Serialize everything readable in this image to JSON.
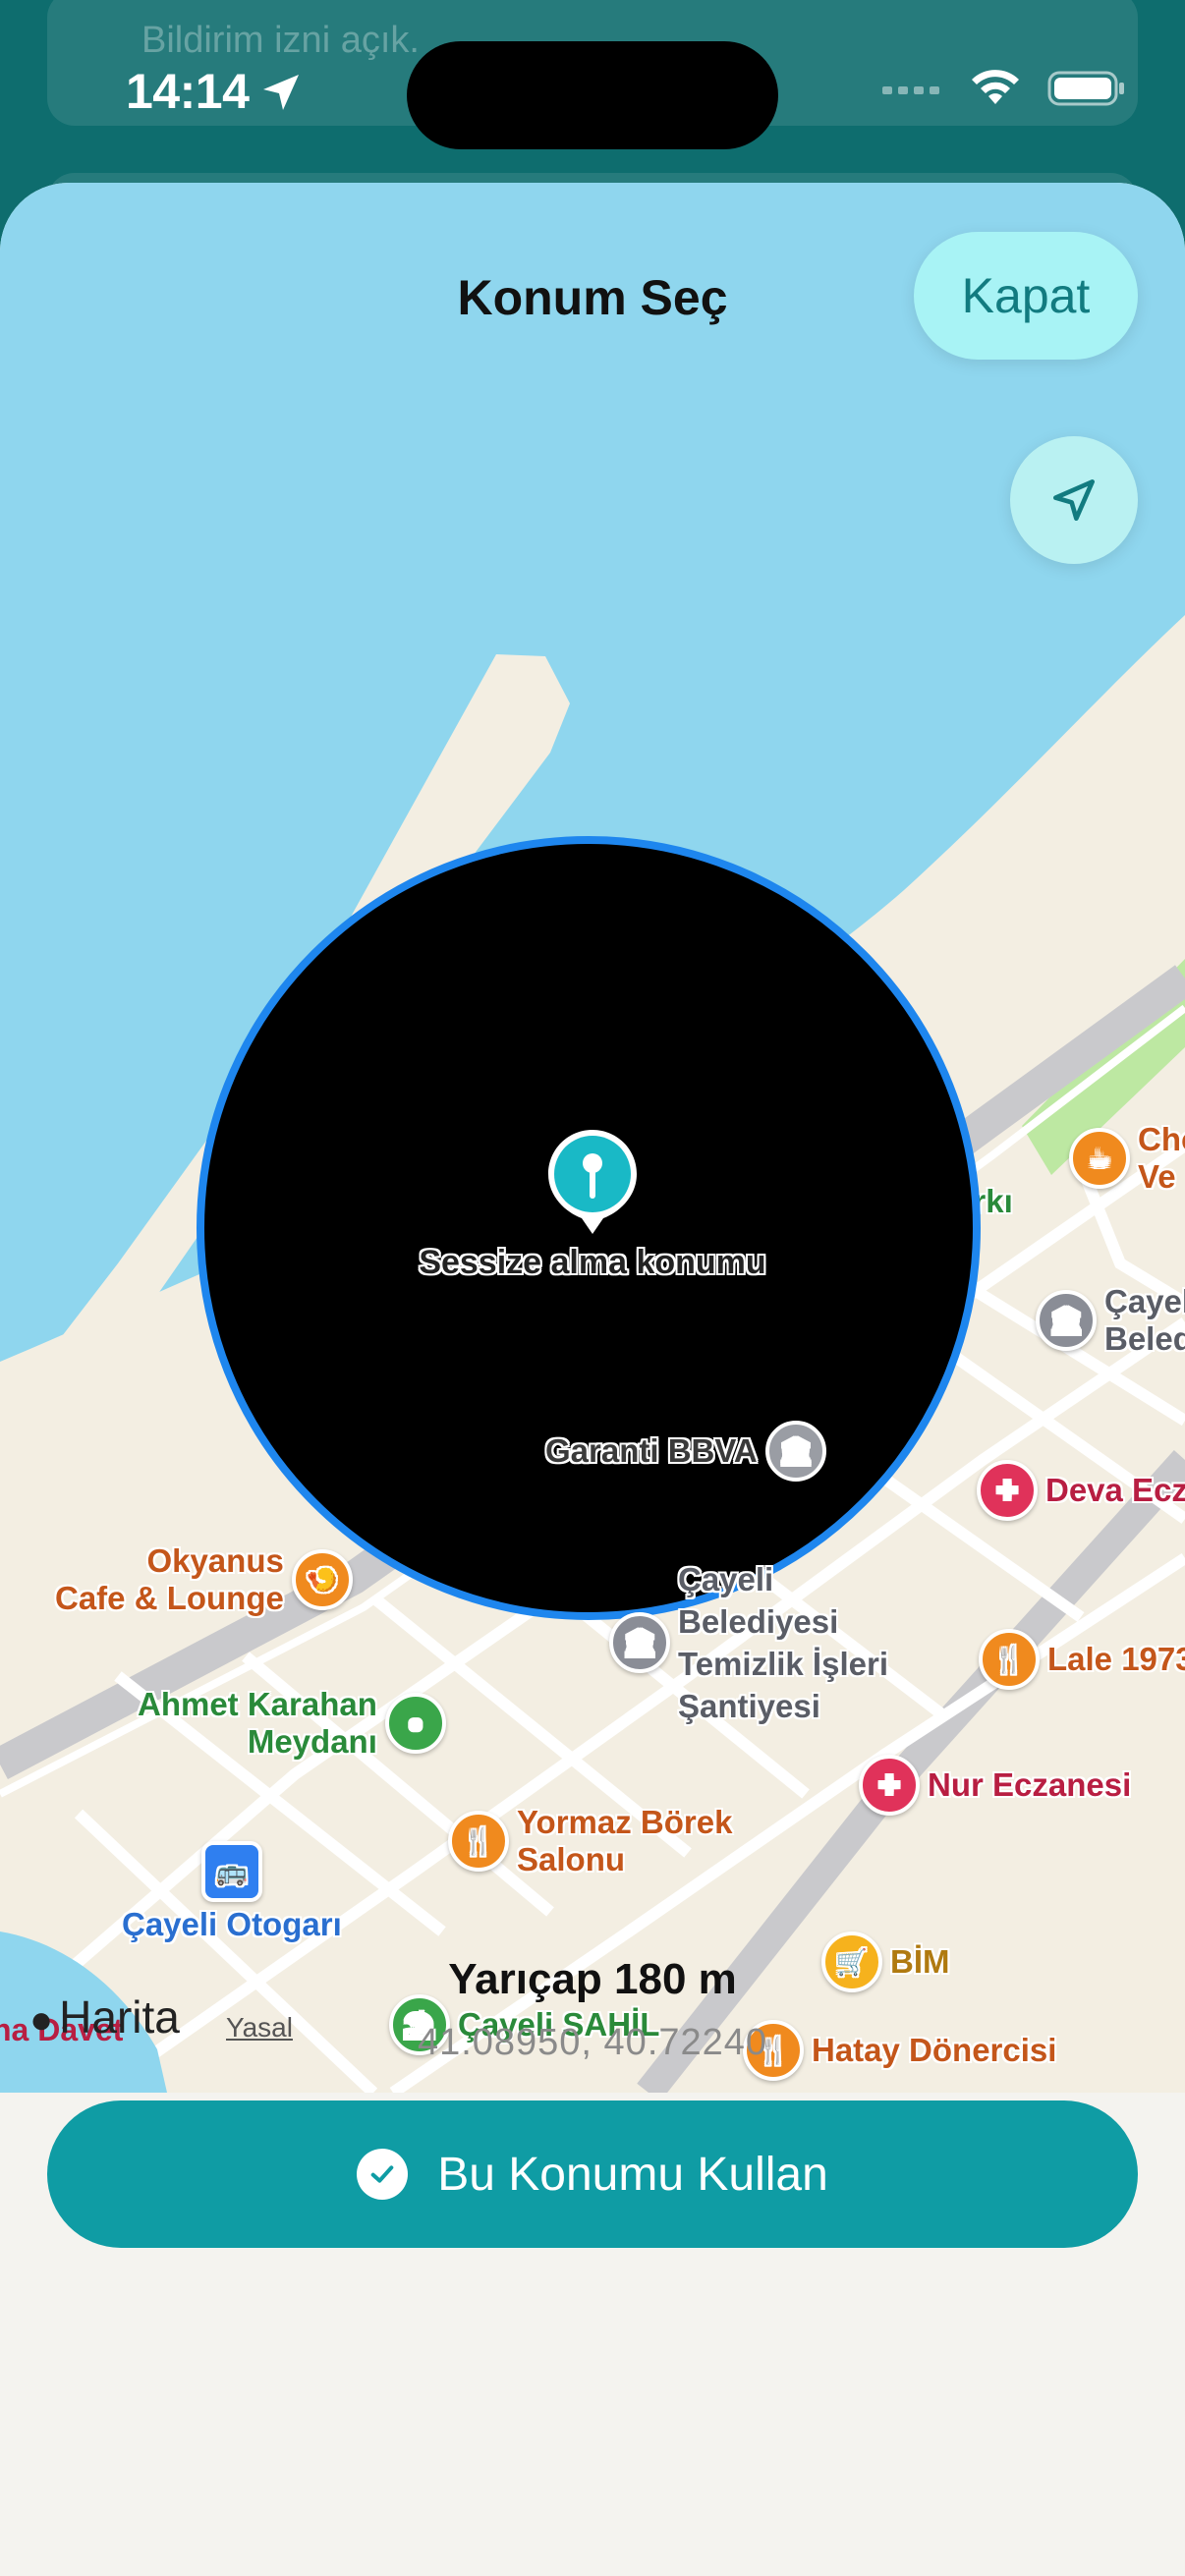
{
  "status_bar": {
    "time": "14:14"
  },
  "background": {
    "notification_text": "Bildirim izni açık."
  },
  "sheet": {
    "title": "Konum Seç",
    "close_label": "Kapat"
  },
  "map": {
    "center_label": "Sessize alma konumu",
    "logo_text": "Harita",
    "legal_text": "Yasal",
    "davet_text": "na Davet",
    "pois": {
      "cocuk_parki": "Çocuk Parkı",
      "garanti": "Garanti BBVA",
      "okyanus_1": "Okyanus",
      "okyanus_2": "Cafe & Lounge",
      "belediye_1": "Çayeli",
      "belediye_2": "Belediyesi",
      "belediye_3": "Temizlik İşleri",
      "belediye_4": "Şantiyesi",
      "ahmet_1": "Ahmet Karahan",
      "ahmet_2": "Meydanı",
      "yormaz_1": "Yormaz Börek",
      "yormaz_2": "Salonu",
      "otogar": "Çayeli Otogarı",
      "sahil": "Çayeli SAHİL",
      "bim": "BİM",
      "hatay": "Hatay Dönercisi",
      "nur": "Nur Eczanesi",
      "lale": "Lale 1973",
      "deva": "Deva Ecz",
      "cayeli_bel_1": "Çayel",
      "cayeli_bel_2": "Beled",
      "cho_1": "Cho",
      "cho_2": "Ve"
    }
  },
  "panel": {
    "radius_text": "Yarıçap 180 m",
    "coordinates": "41.08950, 40.72240",
    "use_button": "Bu Konumu Kullan"
  },
  "colors": {
    "accent": "#0f9ca4",
    "circle_border": "#1e86ee",
    "water": "#8fd6ee"
  }
}
